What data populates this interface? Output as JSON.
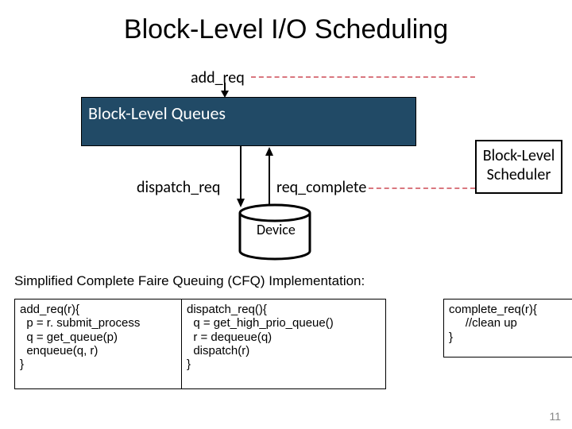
{
  "title": "Block-Level I/O Scheduling",
  "labels": {
    "add_req": "add_req",
    "dispatch_req": "dispatch_req",
    "req_complete": "req_complete"
  },
  "queue_box": "Block-Level Queues",
  "scheduler_l1": "Block-Level",
  "scheduler_l2": "Scheduler",
  "device": "Device",
  "description": "Simplified Complete Faire Queuing (CFQ) Implementation:",
  "code": {
    "add": "add_req(r){\n  p = r. submit_process\n  q = get_queue(p)\n  enqueue(q, r)\n}",
    "disp": "dispatch_req(){\n  q = get_high_prio_queue()\n  r = dequeue(q)\n  dispatch(r)\n}",
    "comp": "complete_req(r){\n     //clean up\n}"
  },
  "slide_number": "11"
}
